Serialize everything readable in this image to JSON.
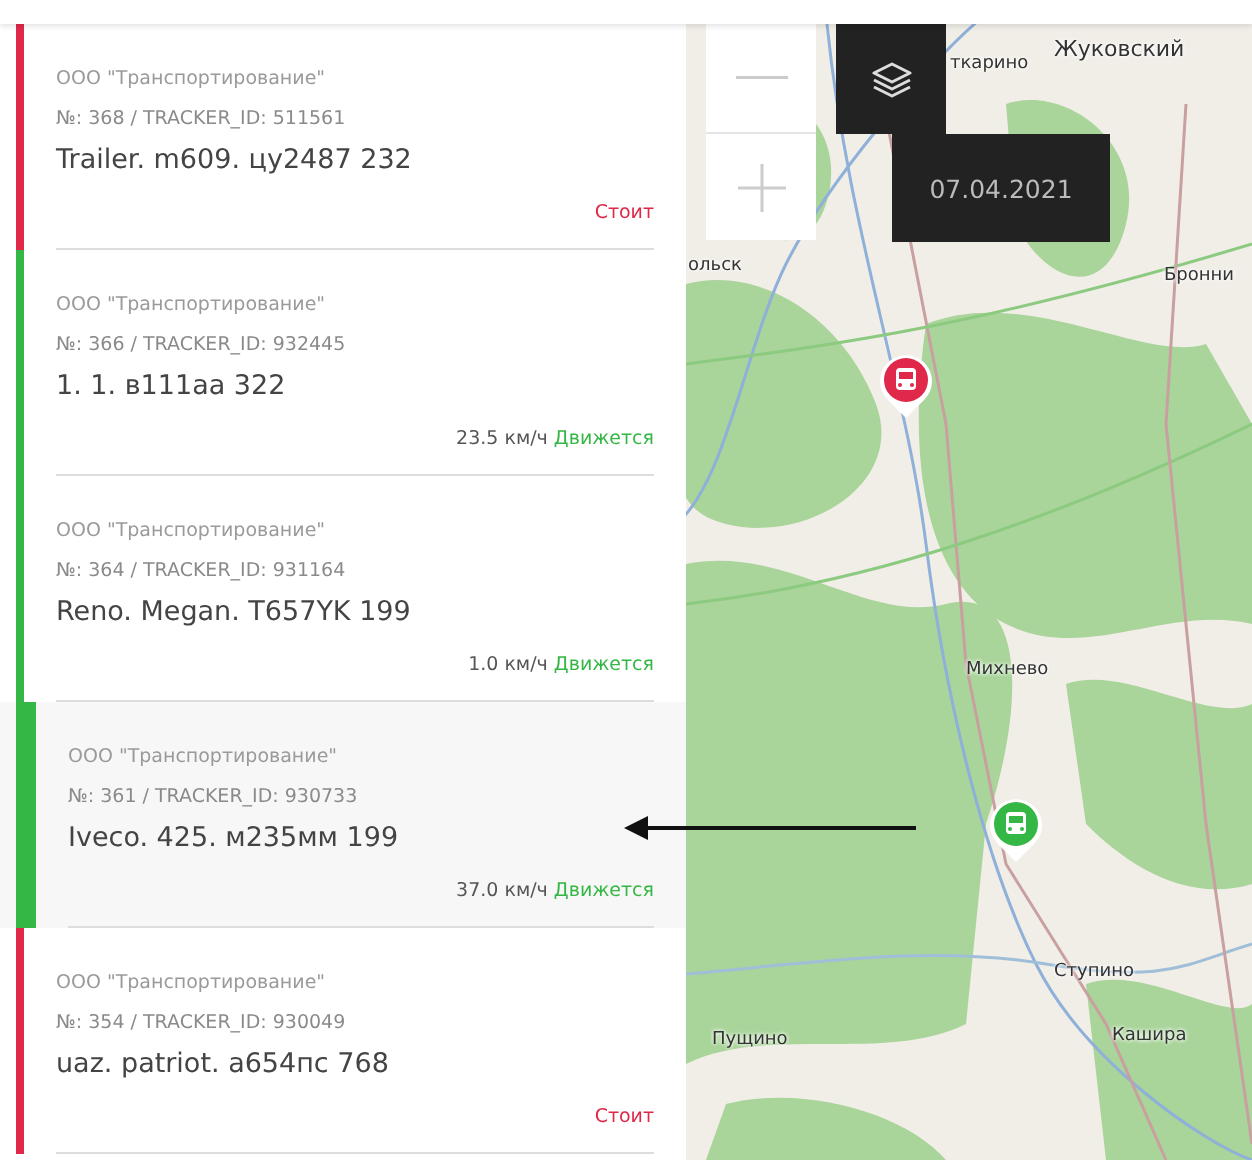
{
  "vehicles": [
    {
      "company": "ООО \"Транспортирование\"",
      "number": "№: 368 / TRACKER_ID: 511561",
      "name": "Trailer. m609. цу2487 232",
      "kind": "stopped",
      "status": "Стоит",
      "selected": false
    },
    {
      "company": "ООО \"Транспортирование\"",
      "number": "№: 366 / TRACKER_ID: 932445",
      "name": "1. 1. в111аа 322",
      "kind": "moving",
      "speed": "23.5 км/ч",
      "status": "Движется",
      "selected": false
    },
    {
      "company": "ООО \"Транспортирование\"",
      "number": "№: 364 / TRACKER_ID: 931164",
      "name": "Reno. Megan. T657YK 199",
      "kind": "moving",
      "speed": "1.0 км/ч",
      "status": "Движется",
      "selected": false
    },
    {
      "company": "ООО \"Транспортирование\"",
      "number": "№: 361 / TRACKER_ID: 930733",
      "name": "Iveco. 425. м235мм 199",
      "kind": "moving",
      "speed": "37.0 км/ч",
      "status": "Движется",
      "selected": true
    },
    {
      "company": "ООО \"Транспортирование\"",
      "number": "№: 354 / TRACKER_ID: 930049",
      "name": "uaz. patriot. а654пс 768",
      "kind": "stopped",
      "status": "Стоит",
      "selected": false
    }
  ],
  "map": {
    "date": "07.04.2021",
    "labels": [
      "Жуковский",
      "ткарино",
      "ольск",
      "Бронни",
      "Михнево",
      "Ступино",
      "Пущино",
      "Кашира"
    ],
    "pins": [
      {
        "kind": "stopped"
      },
      {
        "kind": "moving"
      }
    ]
  }
}
